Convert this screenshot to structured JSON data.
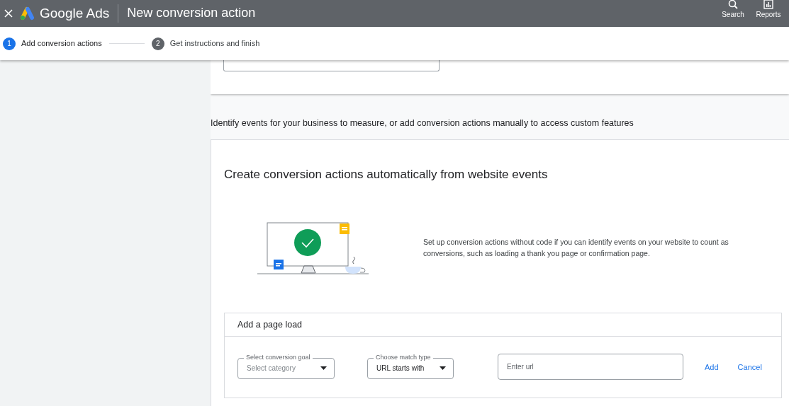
{
  "header": {
    "brand": "Google Ads",
    "title": "New conversion action",
    "actions": [
      {
        "kind": "search",
        "label": "Search"
      },
      {
        "kind": "reports",
        "label": "Reports"
      }
    ]
  },
  "steps": [
    {
      "number": "1",
      "label": "Add conversion actions",
      "selected": true
    },
    {
      "number": "2",
      "label": "Get instructions and finish",
      "selected": false
    }
  ],
  "intro": "Identify events for your business to measure, or add conversion actions manually to access custom features",
  "auto_card": {
    "title": "Create conversion actions automatically from website events",
    "description": "Set up conversion actions without code if you can identify events on your website to count as conversions, such as loading a thank you page or confirmation page.",
    "page_load": {
      "title": "Add a page load",
      "goal": {
        "label": "Select conversion goal",
        "placeholder": "Select category"
      },
      "match": {
        "label": "Choose match type",
        "value": "URL starts with"
      },
      "url": {
        "placeholder": "Enter url"
      },
      "buttons": [
        "Add",
        "Cancel"
      ]
    }
  }
}
